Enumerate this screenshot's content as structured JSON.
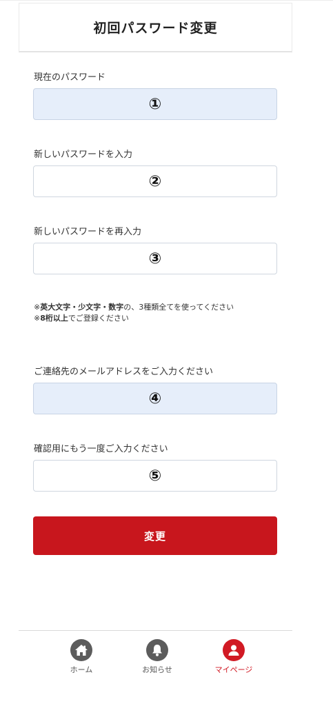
{
  "header": {
    "title": "初回パスワード変更"
  },
  "form": {
    "current_password": {
      "label": "現在のパスワード",
      "value": "①"
    },
    "new_password": {
      "label": "新しいパスワードを入力",
      "value": "②"
    },
    "confirm_password": {
      "label": "新しいパスワードを再入力",
      "value": "③"
    },
    "notes": {
      "line1_prefix": "※",
      "line1_bold": "英大文字・少文字・数字",
      "line1_rest": "の、3種類全てを使ってください",
      "line2_prefix": "※",
      "line2_bold": "8桁以上",
      "line2_rest": "でご登録ください"
    },
    "email": {
      "label": "ご連絡先のメールアドレスをご入力ください",
      "value": "④"
    },
    "email_confirm": {
      "label": "確認用にもう一度ご入力ください",
      "value": "⑤"
    },
    "submit_label": "変更"
  },
  "nav": {
    "items": [
      {
        "label": "ホーム",
        "icon": "home-icon",
        "active": false
      },
      {
        "label": "お知らせ",
        "icon": "bell-icon",
        "active": false
      },
      {
        "label": "マイページ",
        "icon": "user-icon",
        "active": true
      }
    ]
  },
  "colors": {
    "accent": "#c8161d",
    "filled_field": "#e6eefa",
    "nav_inactive": "#5c5c5c",
    "nav_active": "#d11a24"
  }
}
